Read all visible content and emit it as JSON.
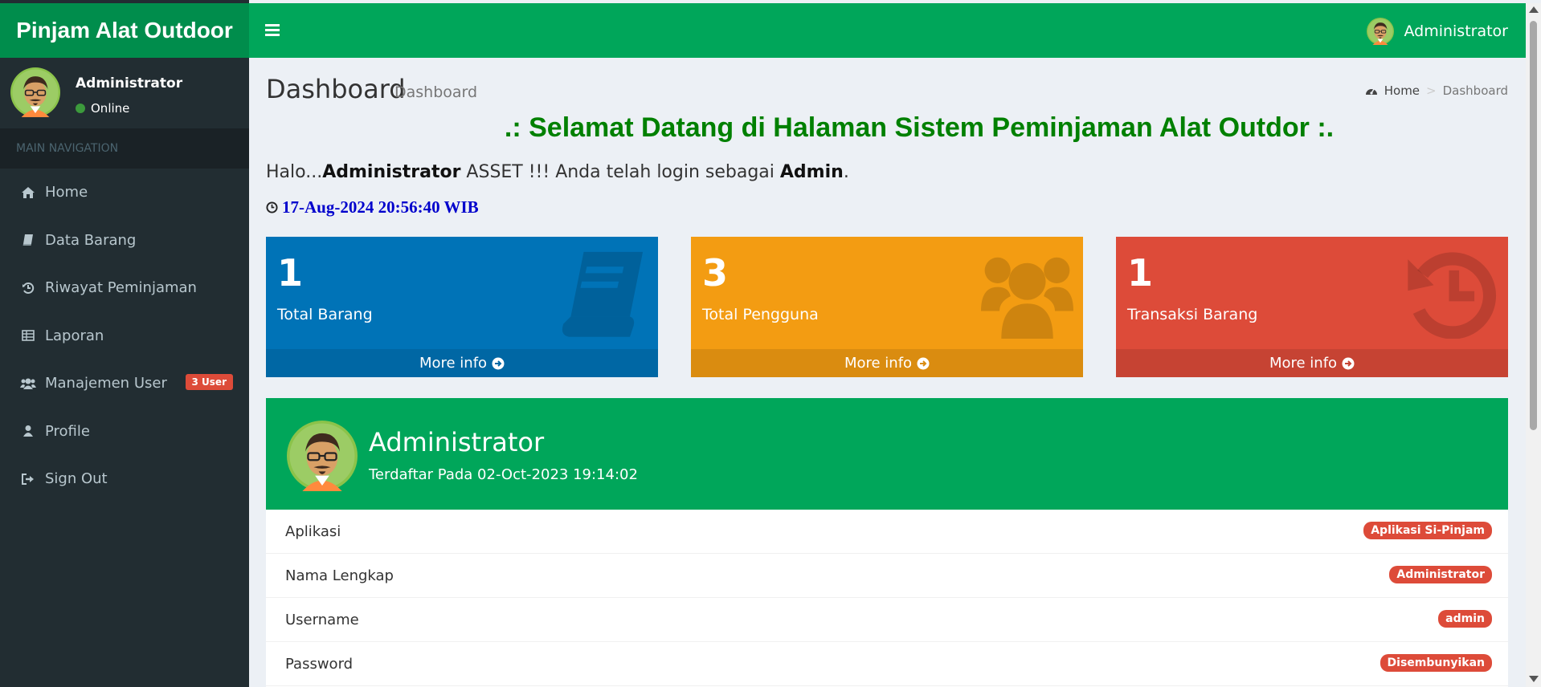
{
  "app": {
    "brand": "Pinjam Alat Outdoor"
  },
  "user_panel": {
    "name": "Administrator",
    "status": "Online"
  },
  "nav": {
    "header": "MAIN NAVIGATION",
    "items": [
      {
        "label": "Home",
        "icon": "home-icon"
      },
      {
        "label": "Data Barang",
        "icon": "book-icon"
      },
      {
        "label": "Riwayat Peminjaman",
        "icon": "history-icon"
      },
      {
        "label": "Laporan",
        "icon": "table-icon"
      },
      {
        "label": "Manajemen User",
        "icon": "users-icon",
        "badge": "3 User"
      },
      {
        "label": "Profile",
        "icon": "user-icon"
      },
      {
        "label": "Sign Out",
        "icon": "sign-out-icon"
      }
    ]
  },
  "topbar": {
    "user": "Administrator"
  },
  "page": {
    "title": "Dashboard",
    "subtitle": "Dashboard",
    "breadcrumb": {
      "home": "Home",
      "current": "Dashboard",
      "separator": ">"
    },
    "welcome": ".: Selamat Datang di Halaman Sistem Peminjaman Alat Outdor :.",
    "greeting": {
      "prefix": "Halo...",
      "name": "Administrator",
      "middle": " ASSET !!! Anda telah login sebagai ",
      "role": "Admin",
      "suffix": "."
    },
    "clock": "17-Aug-2024 20:56:40 WIB"
  },
  "stats": [
    {
      "value": "1",
      "label": "Total Barang",
      "more": "More info",
      "color": "#0073b7",
      "icon": "book-icon"
    },
    {
      "value": "3",
      "label": "Total Pengguna",
      "more": "More info",
      "color": "#f39c12",
      "icon": "users-icon"
    },
    {
      "value": "1",
      "label": "Transaksi Barang",
      "more": "More info",
      "color": "#dd4b39",
      "icon": "history-icon"
    }
  ],
  "profile": {
    "name": "Administrator",
    "registered": "Terdaftar Pada 02-Oct-2023 19:14:02",
    "rows": [
      {
        "label": "Aplikasi",
        "value": "Aplikasi Si-Pinjam"
      },
      {
        "label": "Nama Lengkap",
        "value": "Administrator"
      },
      {
        "label": "Username",
        "value": "admin"
      },
      {
        "label": "Password",
        "value": "Disembunyikan"
      }
    ]
  },
  "colors": {
    "sidebar": "#222d32",
    "header": "#00a65a",
    "logo": "#008d4c",
    "welcome": "#008000",
    "clock": "#0000cc",
    "badge": "#dd4b39"
  }
}
